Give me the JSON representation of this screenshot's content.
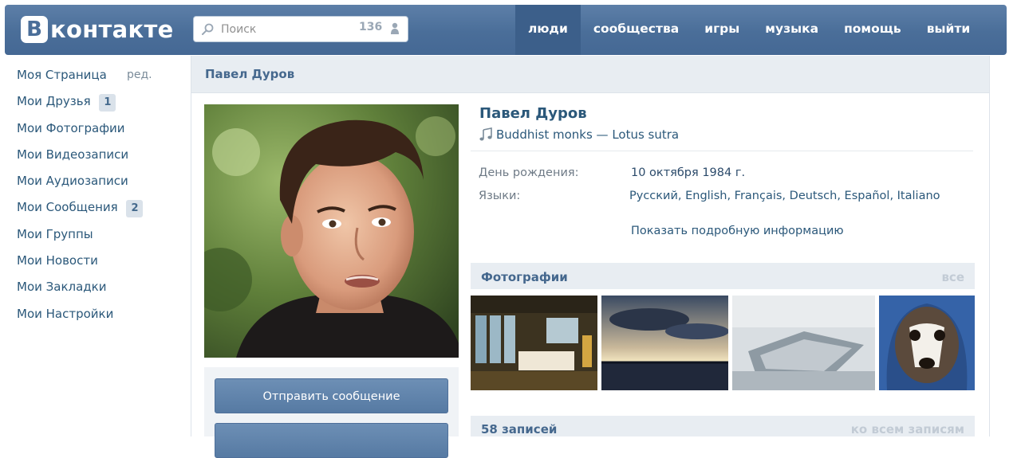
{
  "header": {
    "logo_letter": "В",
    "logo_text": "контакте",
    "search_placeholder": "Поиск",
    "online_count": "136",
    "nav": [
      {
        "label": "люди",
        "active": true
      },
      {
        "label": "сообщества",
        "active": false
      },
      {
        "label": "игры",
        "active": false
      },
      {
        "label": "музыка",
        "active": false
      },
      {
        "label": "помощь",
        "active": false
      },
      {
        "label": "выйти",
        "active": false
      }
    ]
  },
  "sidebar": {
    "edit_label": "ред.",
    "items": [
      {
        "label": "Моя Страница",
        "badge": ""
      },
      {
        "label": "Мои Друзья",
        "badge": "1"
      },
      {
        "label": "Мои Фотографии",
        "badge": ""
      },
      {
        "label": "Мои Видеозаписи",
        "badge": ""
      },
      {
        "label": "Мои Аудиозаписи",
        "badge": ""
      },
      {
        "label": "Мои Сообщения",
        "badge": "2"
      },
      {
        "label": "Мои Группы",
        "badge": ""
      },
      {
        "label": "Мои Новости",
        "badge": ""
      },
      {
        "label": "Мои Закладки",
        "badge": ""
      },
      {
        "label": "Мои Настройки",
        "badge": ""
      }
    ]
  },
  "profile": {
    "header_title": "Павел Дуров",
    "name": "Павел Дуров",
    "status": "Buddhist monks — Lotus sutra",
    "birthday_label": "День рождения:",
    "birthday_value": "10 октября 1984 г.",
    "languages_label": "Языки:",
    "languages_value": "Русский, English, Français, Deutsch, Español, Italiano",
    "more_info": "Показать подробную информацию",
    "send_message": "Отправить сообщение"
  },
  "photos": {
    "title": "Фотографии",
    "all_label": "все"
  },
  "posts": {
    "title": "58 записей",
    "all_label": "ко всем записям"
  },
  "colors": {
    "header": "#4a6e99",
    "link": "#2b587a",
    "section_bg": "#e8edf2"
  }
}
